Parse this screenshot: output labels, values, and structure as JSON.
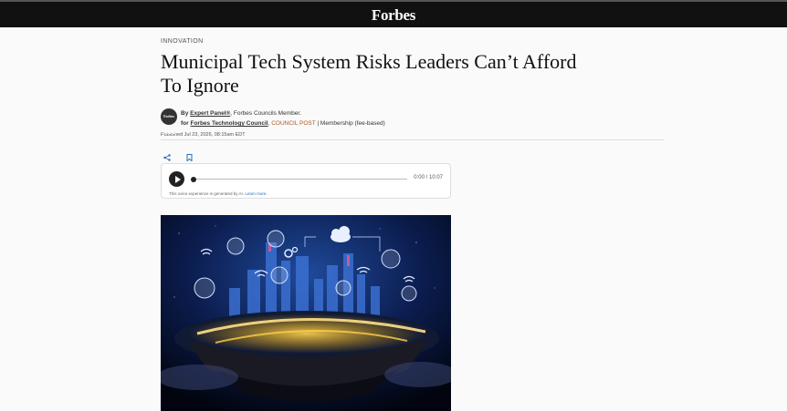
{
  "header": {
    "logo": "Forbes"
  },
  "article": {
    "category": "INNOVATION",
    "title": "Municipal Tech System Risks Leaders Can’t Afford To Ignore",
    "byline": {
      "by": "By",
      "author": "Expert Panel®",
      "role": ", Forbes Councils Member.",
      "for": "for",
      "council": "Forbes Technology Council",
      "sep": ",",
      "post_type": "COUNCIL POST",
      "membership": " | Membership (fee-based)"
    },
    "published": "Published Jul 23, 2026, 08:15am EDT",
    "avatar_text": "Forbes Councils"
  },
  "player": {
    "time": "0:00 / 10:07",
    "note": "This voice experience is generated by AI.",
    "learn_more": "Learn more."
  },
  "icons": {
    "share": "share-icon",
    "bookmark": "bookmark-icon",
    "play": "play-icon"
  }
}
